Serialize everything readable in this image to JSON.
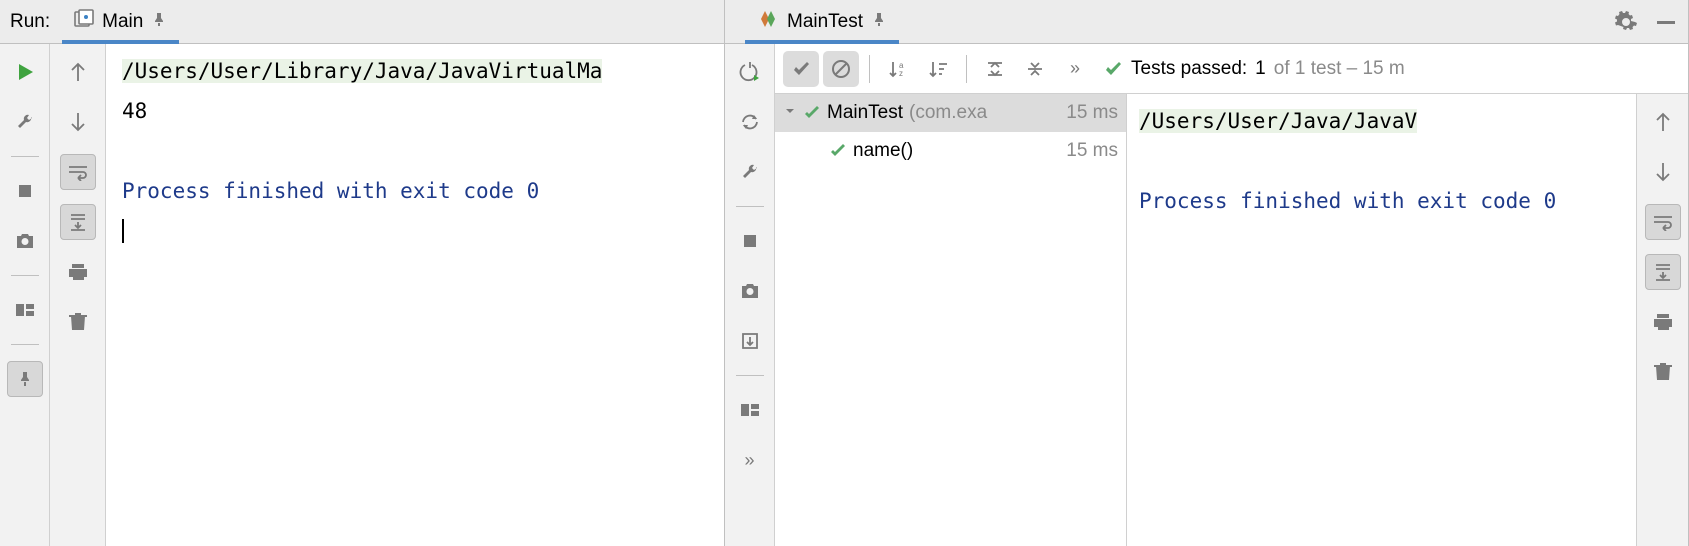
{
  "left": {
    "run_label": "Run:",
    "tab_label": "Main",
    "console": {
      "path": "/Users/User/Library/Java/JavaVirtualMa",
      "output": "48",
      "exit_msg": "Process finished with exit code 0"
    }
  },
  "right": {
    "tab_label": "MainTest",
    "status": {
      "label": "Tests passed:",
      "count": "1",
      "suffix": "of 1 test – 15 m"
    },
    "tree": {
      "root_name": "MainTest",
      "root_pkg": "(com.exa",
      "root_time": "15 ms",
      "child_name": "name()",
      "child_time": "15 ms"
    },
    "console": {
      "path": "/Users/User/Java/JavaV",
      "exit_msg": "Process finished with exit code 0"
    }
  }
}
